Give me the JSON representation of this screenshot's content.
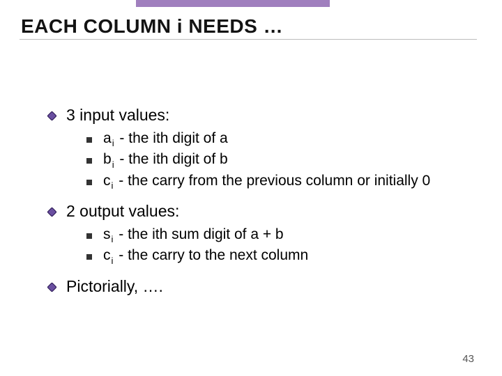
{
  "title": "EACH COLUMN i NEEDS …",
  "sections": [
    {
      "heading": "3 input values:",
      "items": [
        {
          "var": "a",
          "sub": "i",
          "desc": " - the ith digit of a"
        },
        {
          "var": "b",
          "sub": "i",
          "desc": " - the ith digit of b"
        },
        {
          "var": "c",
          "sub": "i",
          "desc": " - the carry from the previous column or initially 0"
        }
      ]
    },
    {
      "heading": "2 output values:",
      "items": [
        {
          "var": "s",
          "sub": "i",
          "desc": " - the ith sum digit of a + b"
        },
        {
          "var": "c",
          "sub": "i",
          "desc": " - the carry to the next column"
        }
      ]
    },
    {
      "heading": "Pictorially, ….",
      "items": []
    }
  ],
  "page_number": "43"
}
